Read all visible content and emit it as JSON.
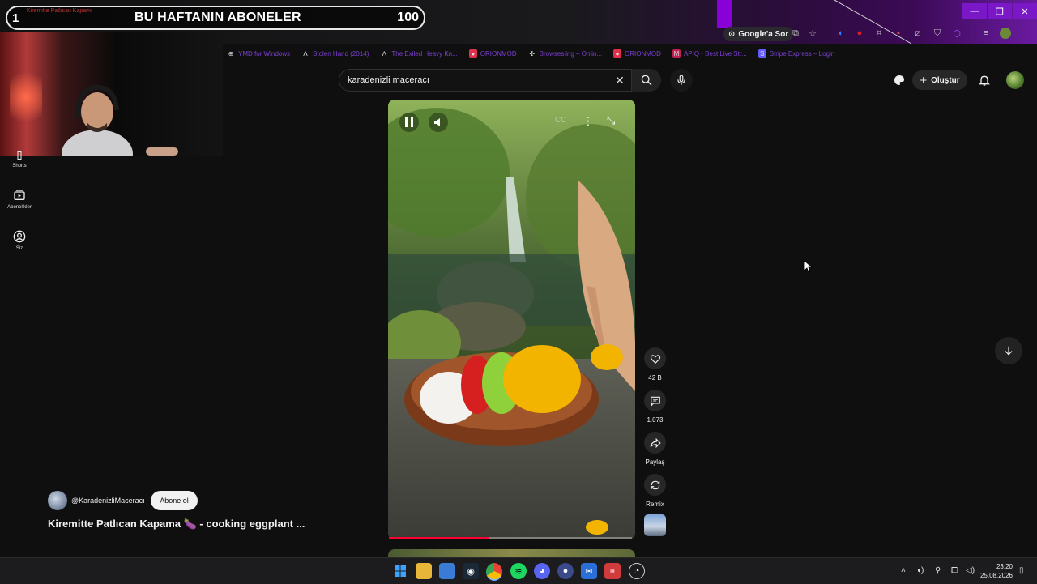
{
  "overlay": {
    "rank": "1",
    "ticker": "Kiremitte Patlıcan Kapamı",
    "title": "BU HAFTANIN ABONELER",
    "count": "100"
  },
  "browser": {
    "google_sor": "Google'a Sor",
    "bookmarks": [
      {
        "label": "YMD for Windows",
        "icon": "globe-icon",
        "color": "#7d3fd4"
      },
      {
        "label": "Stolen Hand (2014)",
        "icon": "a-logo-icon",
        "color": "#7d3fd4"
      },
      {
        "label": "The Exiled Heavy Kn...",
        "icon": "a-logo-icon",
        "color": "#7d3fd4"
      },
      {
        "label": "ORIONMOD",
        "icon": "patreon-icon",
        "color": "#7d3fd4"
      },
      {
        "label": "Browsesling – Onlin...",
        "icon": "gear-icon",
        "color": "#7d3fd4"
      },
      {
        "label": "ORIONMOD",
        "icon": "patreon-icon",
        "color": "#7d3fd4"
      },
      {
        "label": "APIQ - Best Live Str...",
        "icon": "m-logo-icon",
        "color": "#7d3fd4"
      },
      {
        "label": "Stripe Express – Login",
        "icon": "stripe-icon",
        "color": "#7d3fd4"
      }
    ]
  },
  "youtube": {
    "search": {
      "query": "karadenizli maceracı"
    },
    "create_label": "Oluştur",
    "sidebar": [
      {
        "label": "Shorts",
        "icon": "shorts-icon"
      },
      {
        "label": "Abonelikler",
        "icon": "subscriptions-icon"
      },
      {
        "label": "Siz",
        "icon": "profile-icon"
      }
    ],
    "video": {
      "progress": 0.41
    },
    "actions": [
      {
        "label": "42 B",
        "icon": "like-icon"
      },
      {
        "label": "1.073",
        "icon": "comment-icon"
      },
      {
        "label": "Paylaş",
        "icon": "share-icon"
      },
      {
        "label": "Remix",
        "icon": "remix-icon"
      }
    ],
    "channel": {
      "handle": "@KaradenizliMaceracı",
      "subscribe_label": "Abone ol"
    },
    "title": "Kiremitte Patlıcan Kapama 🍆 - cooking eggplant ..."
  },
  "taskbar": {
    "time": "23:20",
    "date": "25.08.2026"
  },
  "colors": {
    "accent_red": "#ff0033",
    "browser_purple": "#7a18c8"
  }
}
